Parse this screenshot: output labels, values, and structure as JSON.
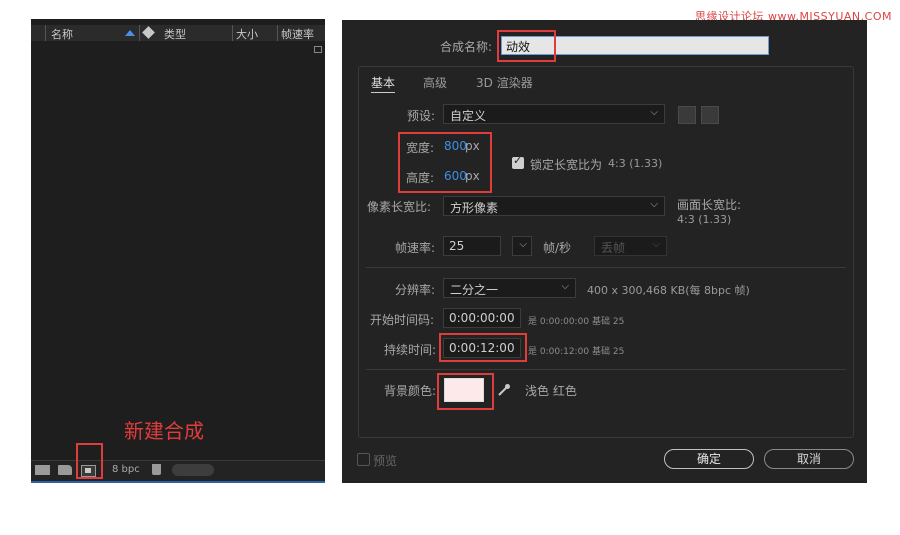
{
  "watermark": "思缘设计论坛 www.MISSYUAN.COM",
  "project_panel": {
    "columns": [
      "名称",
      "类型",
      "大小",
      "帧速率"
    ],
    "footer": {
      "bpc": "8 bpc"
    },
    "caption": "新建合成"
  },
  "dialog": {
    "comp_name_label": "合成名称:",
    "comp_name_value": "动效",
    "tabs": [
      "基本",
      "高级",
      "3D 渲染器"
    ],
    "preset_label": "预设:",
    "preset_value": "自定义",
    "width_label": "宽度:",
    "width_value": "800",
    "height_label": "高度:",
    "height_value": "600",
    "unit_px": "px",
    "lock_label": "锁定长宽比为",
    "lock_ratio": "4:3 (1.33)",
    "pixel_aspect_label": "像素长宽比:",
    "pixel_aspect_value": "方形像素",
    "frame_aspect_label": "画面长宽比:",
    "frame_aspect_value": "4:3 (1.33)",
    "fps_label": "帧速率:",
    "fps_value": "25",
    "fps_unit": "帧/秒",
    "drop_frame": "丢帧",
    "resolution_label": "分辨率:",
    "resolution_value": "二分之一",
    "resolution_info": "400 x 300,468 KB(每 8bpc 帧)",
    "start_tc_label": "开始时间码:",
    "start_tc_value": "0:00:00:00",
    "start_tc_info": "是 0:00:00:00",
    "start_tc_base": "基础 25",
    "duration_label": "持续时间:",
    "duration_value": "0:00:12:00",
    "duration_info": "是 0:00:12:00",
    "duration_base": "基础 25",
    "bg_color_label": "背景颜色:",
    "bg_color_name": "浅色 红色",
    "bg_color_hex": "#fde9e9",
    "preview_label": "预览",
    "ok_label": "确定",
    "cancel_label": "取消"
  }
}
